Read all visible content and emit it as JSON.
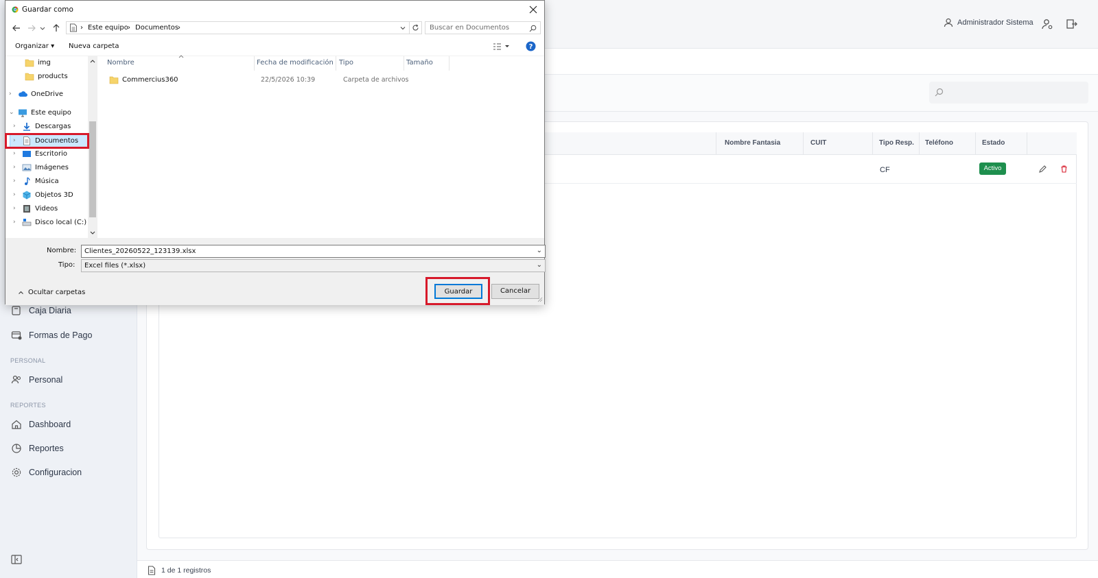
{
  "app": {
    "user_name": "Administrador Sistema",
    "accent_color": "#1e8f4e"
  },
  "sidebar": {
    "items_top": [
      {
        "label": "Caja Diaria",
        "icon": "cash-register-icon"
      },
      {
        "label": "Formas de Pago",
        "icon": "payment-methods-icon"
      }
    ],
    "section_personal": "PERSONAL",
    "personal_item": "Personal",
    "section_reportes": "REPORTES",
    "report_items": [
      {
        "label": "Dashboard",
        "icon": "home-icon"
      },
      {
        "label": "Reportes",
        "icon": "reports-icon"
      },
      {
        "label": "Configuracion",
        "icon": "gear-icon"
      }
    ]
  },
  "table": {
    "headers": [
      "Nombre Fantasia",
      "CUIT",
      "Tipo Resp.",
      "Teléfono",
      "Estado"
    ],
    "rows": [
      {
        "nombre_fantasia": "",
        "cuit": "",
        "tipo_resp": "CF",
        "telefono": "",
        "estado": "Activo"
      }
    ],
    "footer": "1 de 1 registros"
  },
  "dialog": {
    "title": "Guardar como",
    "breadcrumb": [
      "Este equipo",
      "Documentos"
    ],
    "search_placeholder": "Buscar en Documentos",
    "toolbar": {
      "organize": "Organizar",
      "new_folder": "Nueva carpeta"
    },
    "nav_items": [
      {
        "label": "img",
        "icon": "folder-icon",
        "indent": 2
      },
      {
        "label": "products",
        "icon": "folder-icon",
        "indent": 2
      },
      {
        "label": "OneDrive",
        "icon": "cloud-icon",
        "indent": 0
      },
      {
        "label": "Este equipo",
        "icon": "computer-icon",
        "indent": 0
      },
      {
        "label": "Descargas",
        "icon": "download-icon",
        "indent": 1
      },
      {
        "label": "Documentos",
        "icon": "document-icon",
        "indent": 1,
        "selected": true
      },
      {
        "label": "Escritorio",
        "icon": "desktop-icon",
        "indent": 1
      },
      {
        "label": "Imágenes",
        "icon": "pictures-icon",
        "indent": 1
      },
      {
        "label": "Música",
        "icon": "music-icon",
        "indent": 1
      },
      {
        "label": "Objetos 3D",
        "icon": "cube-icon",
        "indent": 1
      },
      {
        "label": "Videos",
        "icon": "video-icon",
        "indent": 1
      },
      {
        "label": "Disco local (C:)",
        "icon": "drive-icon",
        "indent": 1
      }
    ],
    "columns": [
      "Nombre",
      "Fecha de modificación",
      "Tipo",
      "Tamaño"
    ],
    "files": [
      {
        "name": "Commercius360",
        "modified": "22/5/2026 10:39",
        "type": "Carpeta de archivos",
        "size": ""
      }
    ],
    "filename_label": "Nombre:",
    "filename": "Clientes_20260522_123139.xlsx",
    "filetype_label": "Tipo:",
    "filetype": "Excel files (*.xlsx)",
    "hide_folders": "Ocultar carpetas",
    "save_button": "Guardar",
    "cancel_button": "Cancelar",
    "highlight_color": "#d7192a"
  }
}
